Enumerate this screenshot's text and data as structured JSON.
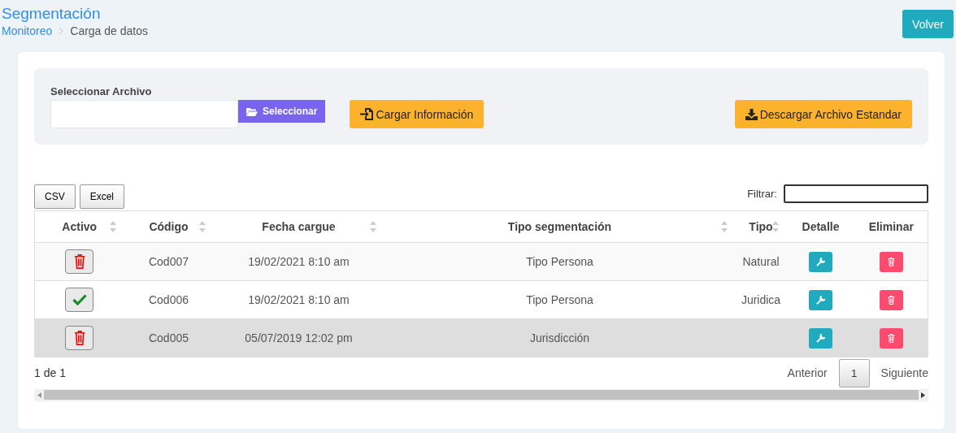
{
  "header": {
    "title": "Segmentación",
    "breadcrumb": [
      {
        "label": "Monitoreo",
        "link": true
      },
      {
        "label": "Carga de datos",
        "link": false
      }
    ],
    "back_button": "Volver"
  },
  "upload": {
    "label": "Seleccionar Archivo",
    "select_button": "Seleccionar",
    "load_button": "Cargar Información",
    "download_button": "Descargar Archivo Estandar"
  },
  "export_buttons": [
    "CSV",
    "Excel"
  ],
  "filter": {
    "label": "Filtrar:"
  },
  "table": {
    "columns": [
      {
        "label": "Activo",
        "sortable": true
      },
      {
        "label": "Código",
        "sortable": true
      },
      {
        "label": "Fecha cargue",
        "sortable": true
      },
      {
        "label": "Tipo segmentación",
        "sortable": true
      },
      {
        "label": "Tipo",
        "sortable": true
      },
      {
        "label": "Detalle",
        "sortable": false
      },
      {
        "label": "Eliminar",
        "sortable": false
      }
    ],
    "rows": [
      {
        "active": false,
        "code": "Cod007",
        "date": "19/02/2021 8:10 am",
        "segmentation": "Tipo Persona",
        "type": "Natural",
        "selected": false
      },
      {
        "active": true,
        "code": "Cod006",
        "date": "19/02/2021 8:10 am",
        "segmentation": "Tipo Persona",
        "type": "Juridica",
        "selected": false
      },
      {
        "active": false,
        "code": "Cod005",
        "date": "05/07/2019 12:02 pm",
        "segmentation": "Jurisdicción",
        "selected": true
      }
    ]
  },
  "footer": {
    "info": "1 de 1",
    "previous": "Anterior",
    "pages": [
      {
        "label": "1",
        "selected": true
      }
    ],
    "next": "Siguiente"
  }
}
